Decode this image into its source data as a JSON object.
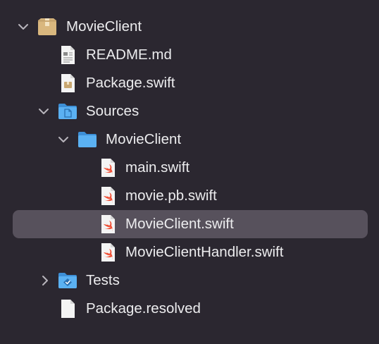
{
  "tree": {
    "root": {
      "label": "MovieClient",
      "icon": "package-icon",
      "expanded": true
    },
    "readme": {
      "label": "README.md",
      "icon": "markdown-file-icon"
    },
    "package_swift": {
      "label": "Package.swift",
      "icon": "package-manifest-icon"
    },
    "sources": {
      "label": "Sources",
      "icon": "sources-folder-icon",
      "expanded": true
    },
    "movieclient_folder": {
      "label": "MovieClient",
      "icon": "folder-icon",
      "expanded": true
    },
    "main_swift": {
      "label": "main.swift",
      "icon": "swift-file-icon"
    },
    "movie_pb_swift": {
      "label": "movie.pb.swift",
      "icon": "swift-file-icon"
    },
    "movieclient_swift": {
      "label": "MovieClient.swift",
      "icon": "swift-file-icon",
      "selected": true
    },
    "handler_swift": {
      "label": "MovieClientHandler.swift",
      "icon": "swift-file-icon"
    },
    "tests": {
      "label": "Tests",
      "icon": "tests-folder-icon",
      "expanded": false
    },
    "package_resolved": {
      "label": "Package.resolved",
      "icon": "file-icon"
    }
  },
  "colors": {
    "background": "#2b2730",
    "selection": "#57515c",
    "text": "#ececee",
    "folder": "#58aef0",
    "swift": "#f05138",
    "package": "#c9a771"
  }
}
